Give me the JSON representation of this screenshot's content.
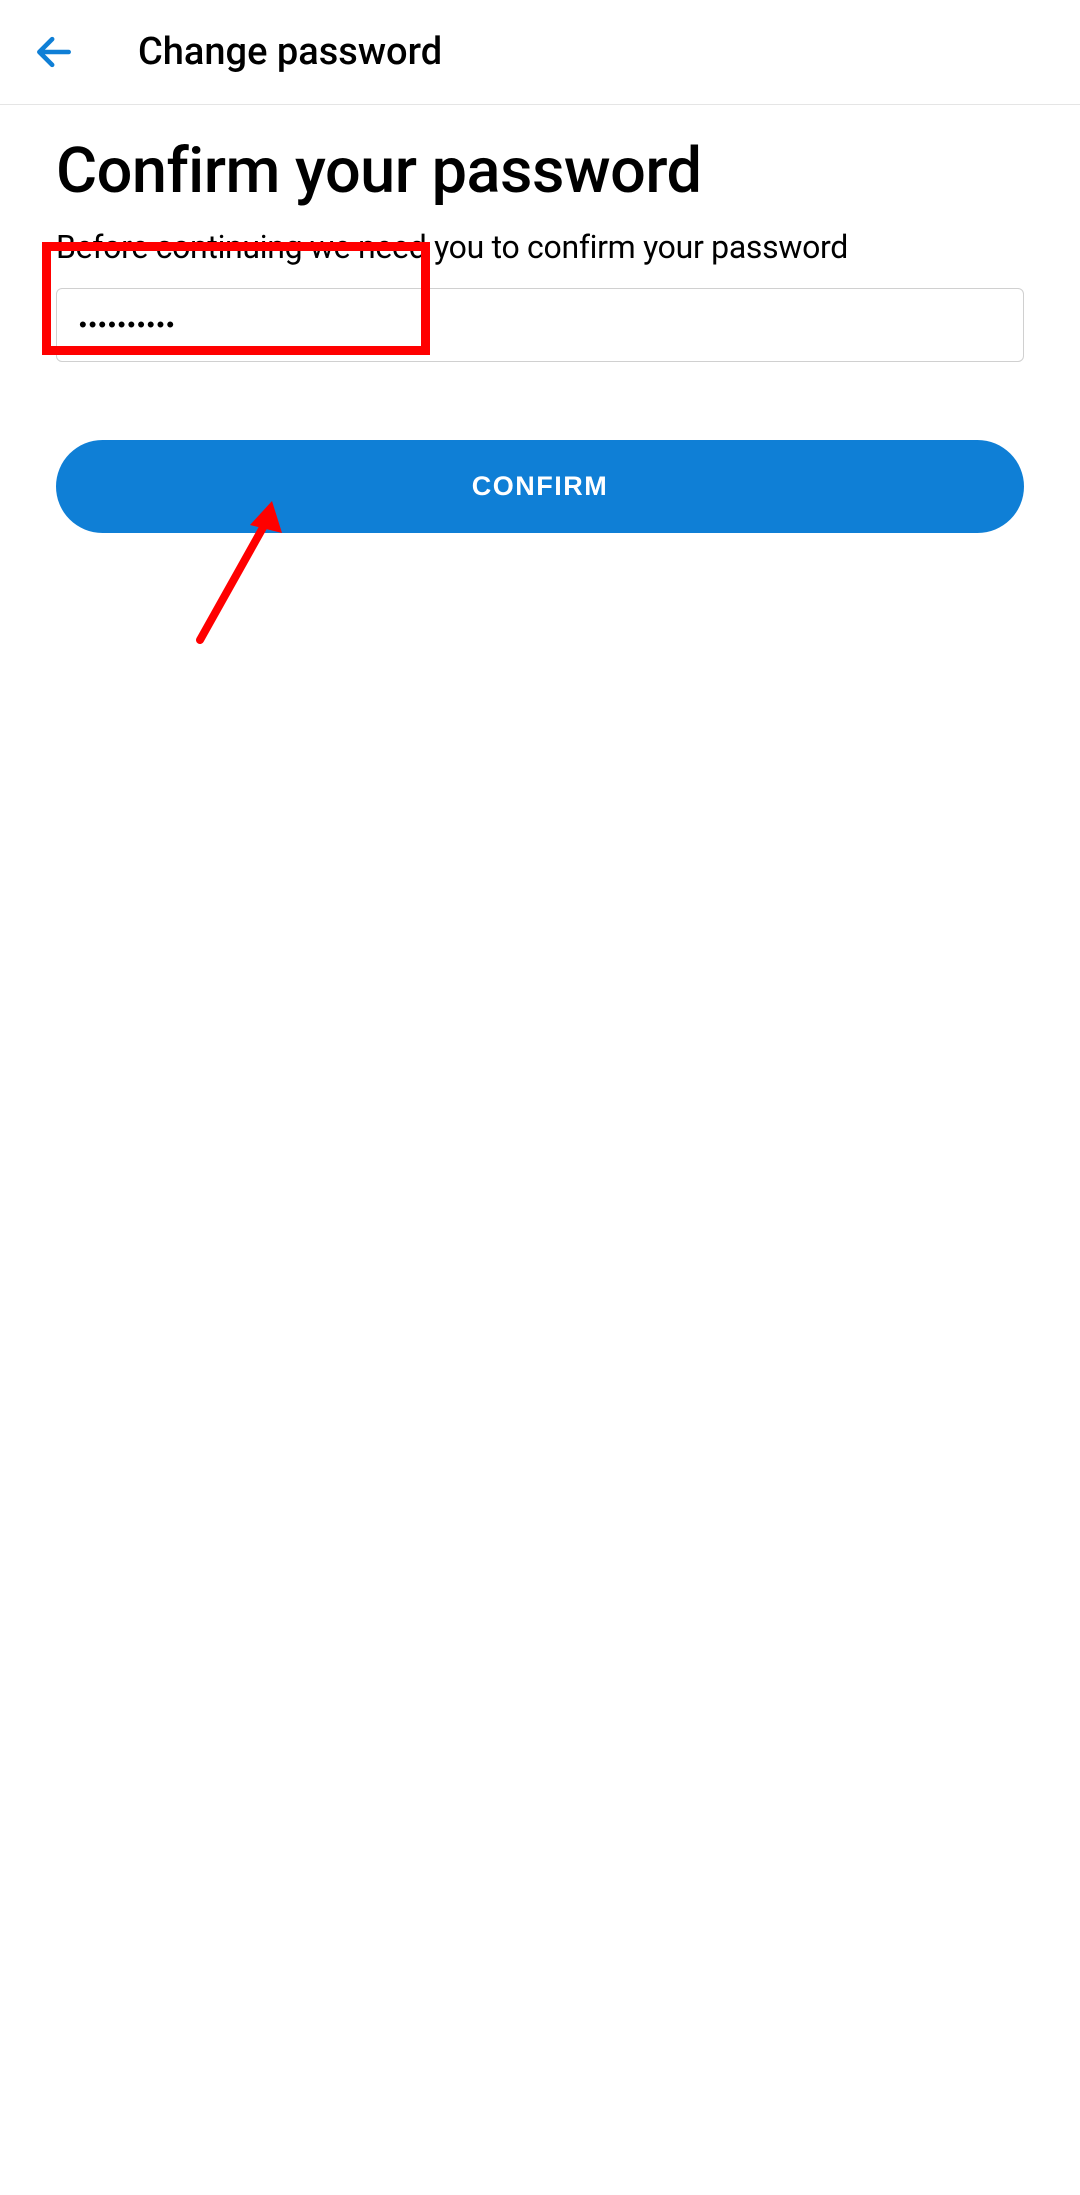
{
  "header": {
    "title": "Change password"
  },
  "main": {
    "heading": "Confirm your password",
    "subtext": "Before continuing we need you to confirm your password",
    "password_value": "••••••••••",
    "confirm_label": "CONFIRM"
  }
}
